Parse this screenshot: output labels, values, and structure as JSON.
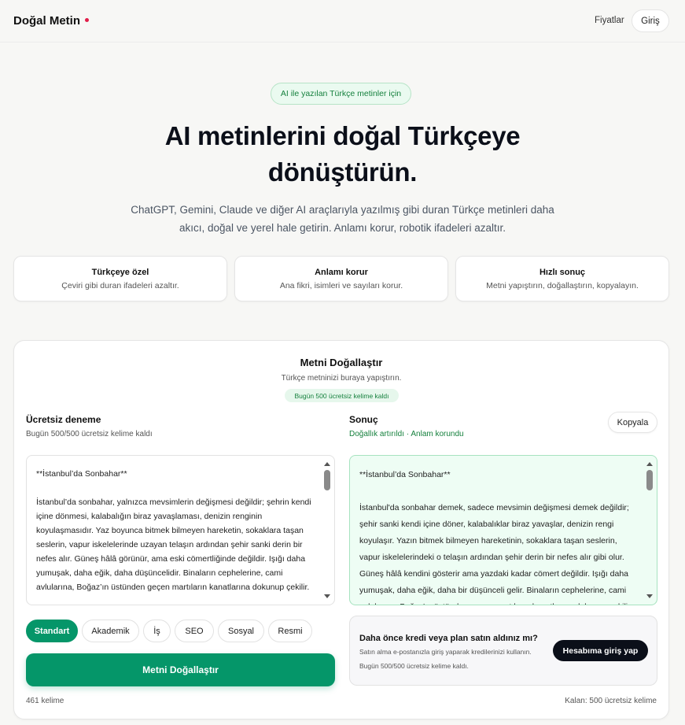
{
  "header": {
    "brand": "Doğal Metin",
    "pricing_label": "Fiyatlar",
    "login_label": "Giriş",
    "brand_dot_color": "#e11d48"
  },
  "hero": {
    "badge": "AI ile yazılan Türkçe metinler için",
    "title": "AI metinlerini doğal Türkçeye dönüştürün.",
    "subtitle": "ChatGPT, Gemini, Claude ve diğer AI araçlarıyla yazılmış gibi duran Türkçe metinleri daha akıcı, doğal ve yerel hale getirin. Anlamı korur, robotik ifadeleri azaltır."
  },
  "features": [
    {
      "title": "Türkçeye özel",
      "desc": "Çeviri gibi duran ifadeleri azaltır."
    },
    {
      "title": "Anlamı korur",
      "desc": "Ana fikri, isimleri ve sayıları korur."
    },
    {
      "title": "Hızlı sonuç",
      "desc": "Metni yapıştırın, doğallaştırın, kopyalayın."
    }
  ],
  "tool": {
    "title": "Metni Doğallaştır",
    "subtitle": "Türkçe metninizi buraya yapıştırın.",
    "quota_badge": "Bugün 500 ücretsiz kelime kaldı",
    "left": {
      "heading": "Ücretsiz deneme",
      "sub": "Bugün 500/500 ücretsiz kelime kaldı",
      "text": "**İstanbul’da Sonbahar**\n\nİstanbul’da sonbahar, yalnızca mevsimlerin değişmesi değildir; şehrin kendi içine dönmesi, kalabalığın biraz yavaşlaması, denizin renginin koyulaşmasıdır. Yaz boyunca bitmek bilmeyen hareketin, sokaklara taşan seslerin, vapur iskelelerinde uzayan telaşın ardından şehir sanki derin bir nefes alır. Güneş hâlâ görünür, ama eski cömertliğinde değildir. Işığı daha yumuşak, daha eğik, daha düşüncelidir. Binaların cephelerine, cami avlularına, Boğaz’ın üstünden geçen martıların kanatlarına dokunup çekilir."
    },
    "right": {
      "heading": "Sonuç",
      "sub": "Doğallık artırıldı · Anlam korundu",
      "copy_label": "Kopyala",
      "text": "**İstanbul’da Sonbahar**\n\nİstanbul'da sonbahar demek, sadece mevsimin değişmesi demek değildir; şehir sanki kendi içine döner, kalabalıklar biraz yavaşlar, denizin rengi koyulaşır. Yazın bitmek bilmeyen hareketinin, sokaklara taşan seslerin, vapur iskelelerindeki o telaşın ardından şehir derin bir nefes alır gibi olur. Güneş hâlâ kendini gösterir ama yazdaki kadar cömert değildir. Işığı daha yumuşak, daha eğik, daha bir düşünceli gelir. Binaların cephelerine, cami avlularına, Boğaz'ın üstünden geçen martıların kanatlarına dokunup çekilir."
    },
    "modes": [
      "Standart",
      "Akademik",
      "İş",
      "SEO",
      "Sosyal",
      "Resmi"
    ],
    "active_mode": "Standart",
    "submit_label": "Metni Doğallaştır",
    "word_count": "461 kelime",
    "remaining": "Kalan: 500 ücretsiz kelime",
    "credit": {
      "title": "Daha önce kredi veya plan satın aldınız mı?",
      "line1": "Satın alma e-postanızla giriş yaparak kredilerinizi kullanın.",
      "line2": "Bugün 500/500 ücretsiz kelime kaldı.",
      "button": "Hesabıma giriş yap"
    },
    "accent_color": "#059669"
  }
}
